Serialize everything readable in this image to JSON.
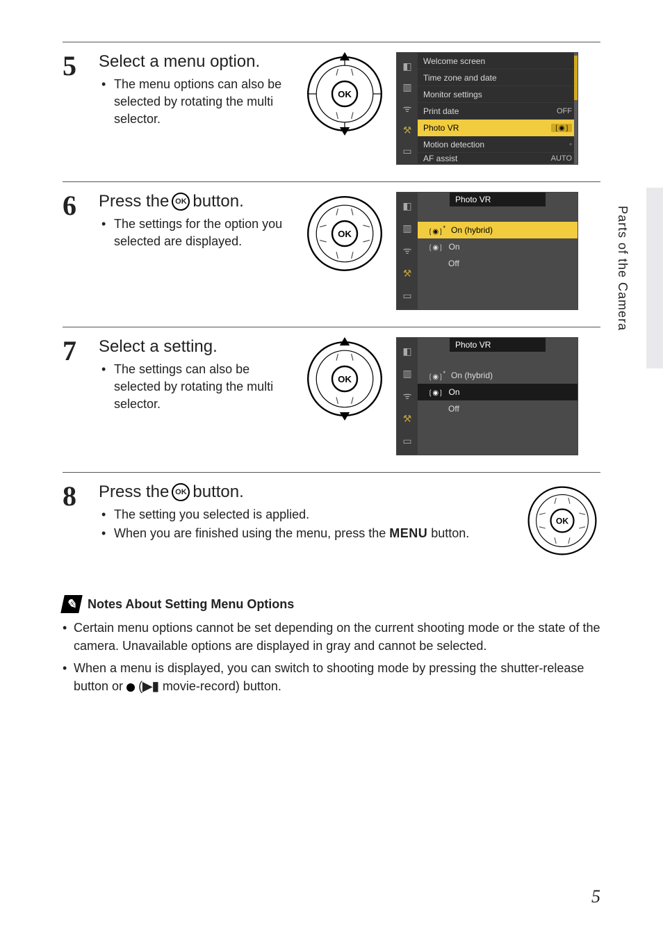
{
  "side_tab_label": "Parts of the Camera",
  "page_number": "5",
  "steps": [
    {
      "num": "5",
      "title": "Select a menu option.",
      "bullets": [
        "The menu options can also be selected by rotating the multi selector."
      ],
      "dial": "vertical",
      "screen": {
        "type": "setup_list",
        "rows": [
          {
            "label": "Welcome screen",
            "val": ""
          },
          {
            "label": "Time zone and date",
            "val": ""
          },
          {
            "label": "Monitor settings",
            "val": ""
          },
          {
            "label": "Print date",
            "val": "OFF"
          },
          {
            "label": "Photo VR",
            "val": "vr",
            "sel": true
          },
          {
            "label": "Motion detection",
            "val": "auto"
          },
          {
            "label": "AF assist",
            "val": "AUTO"
          }
        ]
      }
    },
    {
      "num": "6",
      "title_pre": "Press the ",
      "title_post": " button.",
      "has_ok_in_title": true,
      "bullets": [
        "The settings for the option you selected are displayed."
      ],
      "dial": "plain",
      "screen": {
        "type": "photo_vr",
        "header": "Photo VR",
        "options": [
          {
            "label": "On (hybrid)",
            "icon": "star",
            "sel": "sel1"
          },
          {
            "label": "On",
            "icon": "plain"
          },
          {
            "label": "Off"
          }
        ]
      }
    },
    {
      "num": "7",
      "title": "Select a setting.",
      "bullets": [
        "The settings can also be selected by rotating the multi selector."
      ],
      "dial": "vertical",
      "screen": {
        "type": "photo_vr",
        "header": "Photo VR",
        "options": [
          {
            "label": "On (hybrid)",
            "icon": "star"
          },
          {
            "label": "On",
            "icon": "plain",
            "sel": "sel2"
          },
          {
            "label": "Off"
          }
        ]
      }
    },
    {
      "num": "8",
      "title_pre": "Press the ",
      "title_post": " button.",
      "has_ok_in_title": true,
      "bullets_wide": true,
      "bullets": [
        "The setting you selected is applied.",
        "When you are finished using the menu, press the MENU button."
      ],
      "dial": "plain",
      "dial_right": true
    }
  ],
  "notes": {
    "header": "Notes About Setting Menu Options",
    "items": [
      "Certain menu options cannot be set depending on the current shooting mode or the state of the camera. Unavailable options are displayed in gray and cannot be selected.",
      "When a menu is displayed, you can switch to shooting mode by pressing the shutter-release button or ● (▶▌ movie-record) button."
    ]
  }
}
